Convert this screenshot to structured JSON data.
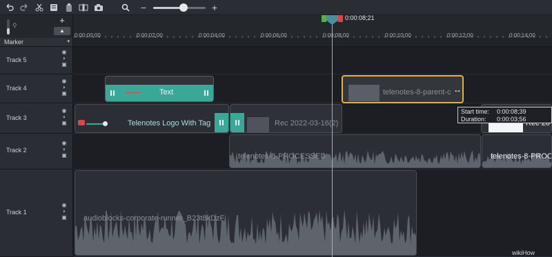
{
  "toolbar": {
    "undo_icon": "undo-icon",
    "redo_icon": "redo-icon",
    "cut_icon": "scissors-icon",
    "copy_icon": "copy-icon",
    "paste_icon": "paste-icon",
    "split_icon": "split-icon",
    "snapshot_icon": "camera-icon",
    "zoom_icon": "search-icon",
    "zoom_out_label": "−",
    "zoom_in_label": "+",
    "zoom_level": 0.58
  },
  "panel": {
    "add_track_label": "+",
    "collapse_label": "▲",
    "marker_label": "Marker",
    "marker_caret": "▾"
  },
  "ruler": {
    "ticks": [
      "0:00:00;00",
      "0:00:02;00",
      "0:00:04;00",
      "0:00:06;00",
      "0:00:08;00",
      "0:00:10;00",
      "0:00:12;00",
      "0:00:14;00"
    ],
    "playhead_time": "0:00:08;21"
  },
  "tracks": [
    {
      "name": "Track 5"
    },
    {
      "name": "Track 4"
    },
    {
      "name": "Track 3"
    },
    {
      "name": "Track 2"
    },
    {
      "name": "Track 1"
    }
  ],
  "clips": {
    "text_clip": "Text",
    "parent_clip": "telenotes-8-parent-c",
    "logo_clip": "Telenotes Logo With Tag",
    "rec_clip": "Rec 2022-03-16(2)",
    "rec_clip_right": "Rec 20",
    "processed_clip": "telenotes-8-PROCESSED",
    "processed_clip_right": "telenotes-8-PROC",
    "audio_clip": "audioblocks-corporate-runner_B23t8kDzF"
  },
  "tooltip": {
    "start_label": "Start time:",
    "start_value": "0:00:08;39",
    "duration_label": "Duration:",
    "duration_value": "0:00:03;56"
  },
  "watermark": "wikiHow",
  "colors": {
    "accent_teal": "#3aa896",
    "selection_outline": "#e2b24a",
    "playhead": "#4c8f9a"
  }
}
